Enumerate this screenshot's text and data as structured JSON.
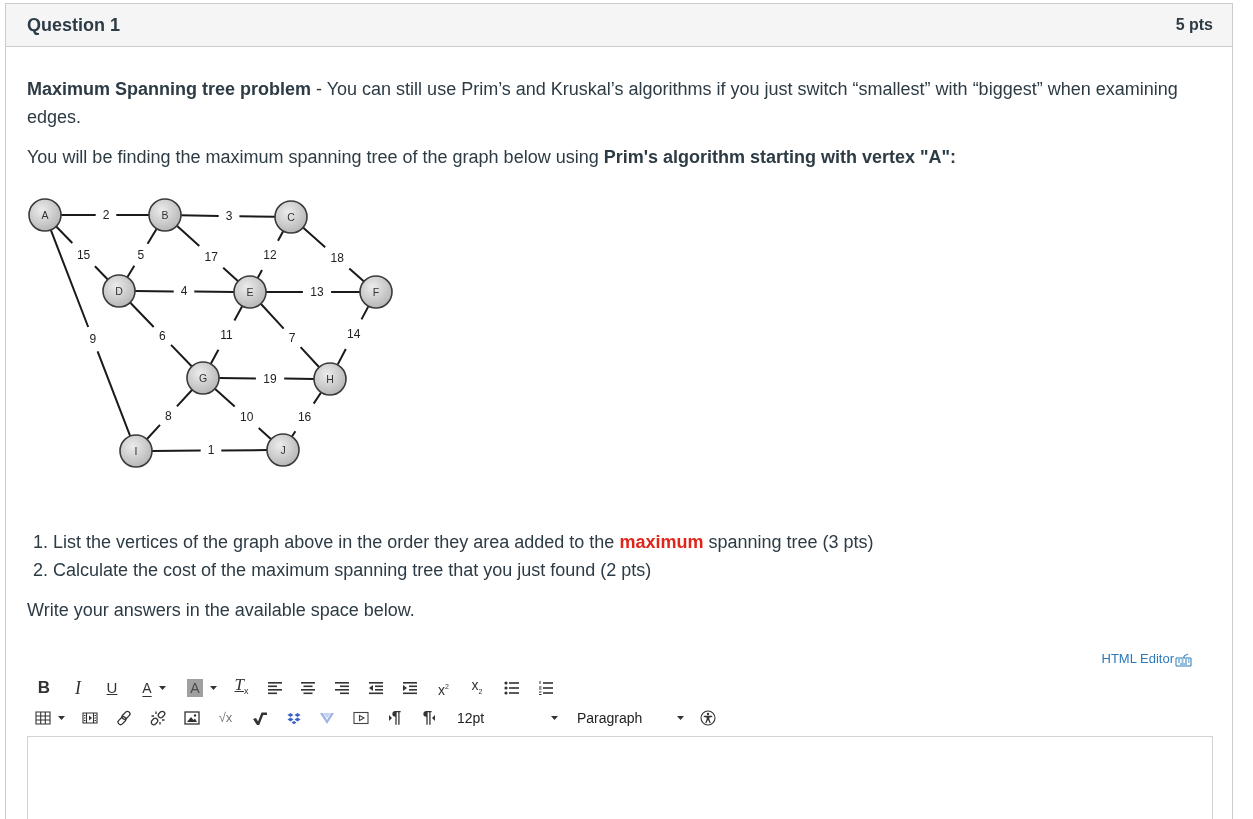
{
  "question": {
    "title": "Question 1",
    "points": "5 pts"
  },
  "intro": [
    "**Maximum Spanning tree problem** - You can still use Prim’s and Kruskal’s algorithms if you just switch “smallest” with “biggest” when examining edges.",
    "You will be finding the maximum spanning tree of the graph below using **Prim's algorithm starting with vertex \"A\":**"
  ],
  "graph": {
    "nodes": [
      "A",
      "B",
      "C",
      "D",
      "E",
      "F",
      "G",
      "H",
      "I",
      "J"
    ],
    "edges": [
      {
        "weight": "2"
      },
      {
        "weight": "3"
      },
      {
        "weight": "15"
      },
      {
        "weight": "5"
      },
      {
        "weight": "17"
      },
      {
        "weight": "12"
      },
      {
        "weight": "18"
      },
      {
        "weight": "4"
      },
      {
        "weight": "13"
      },
      {
        "weight": "9"
      },
      {
        "weight": "6"
      },
      {
        "weight": "11"
      },
      {
        "weight": "7"
      },
      {
        "weight": "14"
      },
      {
        "weight": "19"
      },
      {
        "weight": "8"
      },
      {
        "weight": "10"
      },
      {
        "weight": "16"
      },
      {
        "weight": "1"
      }
    ]
  },
  "tasks": [
    {
      "number": "1.",
      "text": "List the vertices of the graph above in the order they area added to the **maximum** spanning tree (3 pts)"
    },
    {
      "number": "2.",
      "text": "Calculate the cost of the maximum spanning tree that you just found (2 pts)"
    }
  ],
  "instruction": "Write your answers in the available space below.",
  "editor": {
    "html_editor_link": "HTML Editor",
    "toolbar": [
      [
        {
          "kind": "bold",
          "label": "B"
        },
        {
          "kind": "italic",
          "label": "I"
        },
        {
          "kind": "underline",
          "label": "U"
        },
        {
          "kind": "font-color",
          "label": "A"
        },
        {
          "kind": "highlight",
          "label": "A"
        },
        {
          "kind": "clear-format",
          "label": "T$_{x}$"
        },
        {
          "kind": "align-left"
        },
        {
          "kind": "align-center"
        },
        {
          "kind": "align-right"
        },
        {
          "kind": "outdent"
        },
        {
          "kind": "indent"
        },
        {
          "kind": "superscript",
          "label": "x$^{2}$"
        },
        {
          "kind": "subscript",
          "label": "x$_{2}$"
        },
        {
          "kind": "bullet-list"
        },
        {
          "kind": "numbered-list"
        }
      ],
      [
        {
          "kind": "table"
        },
        {
          "kind": "media"
        },
        {
          "kind": "link"
        },
        {
          "kind": "unlink"
        },
        {
          "kind": "image"
        },
        {
          "kind": "math",
          "label": "√x"
        },
        {
          "kind": "check"
        },
        {
          "kind": "diamonds"
        },
        {
          "kind": "chevron"
        },
        {
          "kind": "video"
        },
        {
          "kind": "ltr",
          "label": "¶"
        },
        {
          "kind": "rtl",
          "label": "¶"
        },
        {
          "kind": "font-size",
          "label": "12pt"
        },
        {
          "kind": "block-format",
          "label": "Paragraph"
        },
        {
          "kind": "accessibility"
        }
      ]
    ]
  }
}
